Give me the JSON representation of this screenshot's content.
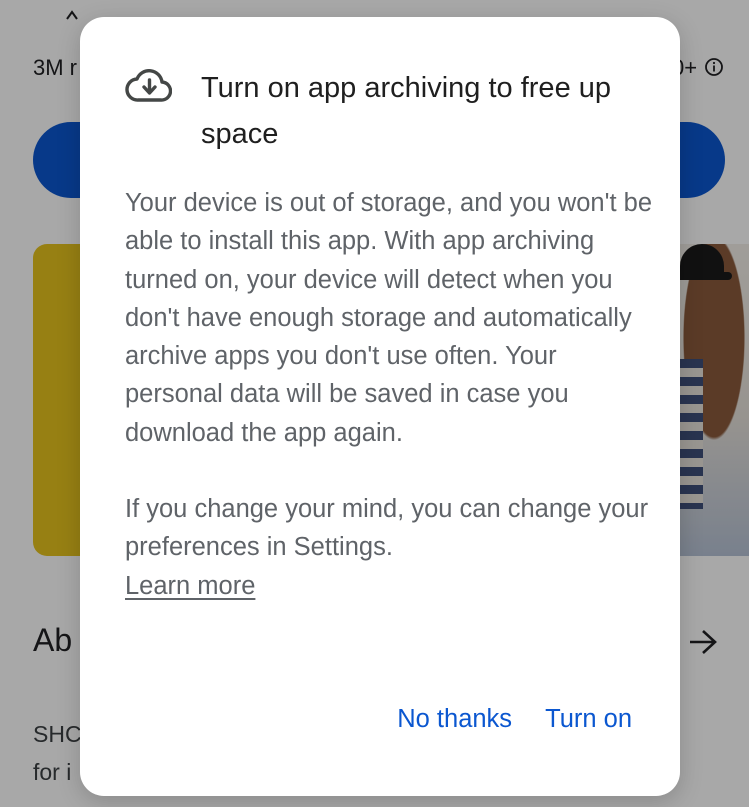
{
  "background": {
    "stat_left": "3M r",
    "stat_right": "0+",
    "about_heading": "Ab",
    "desc_lines": [
      "SHC",
      "for i"
    ]
  },
  "dialog": {
    "icon": "cloud-download-icon",
    "title": "Turn on app archiving to free up space",
    "body_paragraph_1": "Your device is out of storage, and you won't be able to install this app. With app archiving turned on, your device will detect when you don't have enough storage and automatically archive apps you don't use often. Your personal data will be saved in case you download the app again.",
    "body_paragraph_2": "If you change your mind, you can change your preferences in Settings.",
    "learn_more": "Learn more",
    "actions": {
      "dismiss_label": "No thanks",
      "confirm_label": "Turn on"
    }
  },
  "colors": {
    "accent": "#0b57d0",
    "title_text": "#1f1f1f",
    "body_text": "#5f6368",
    "scrim": "rgba(0,0,0,0.34)"
  }
}
